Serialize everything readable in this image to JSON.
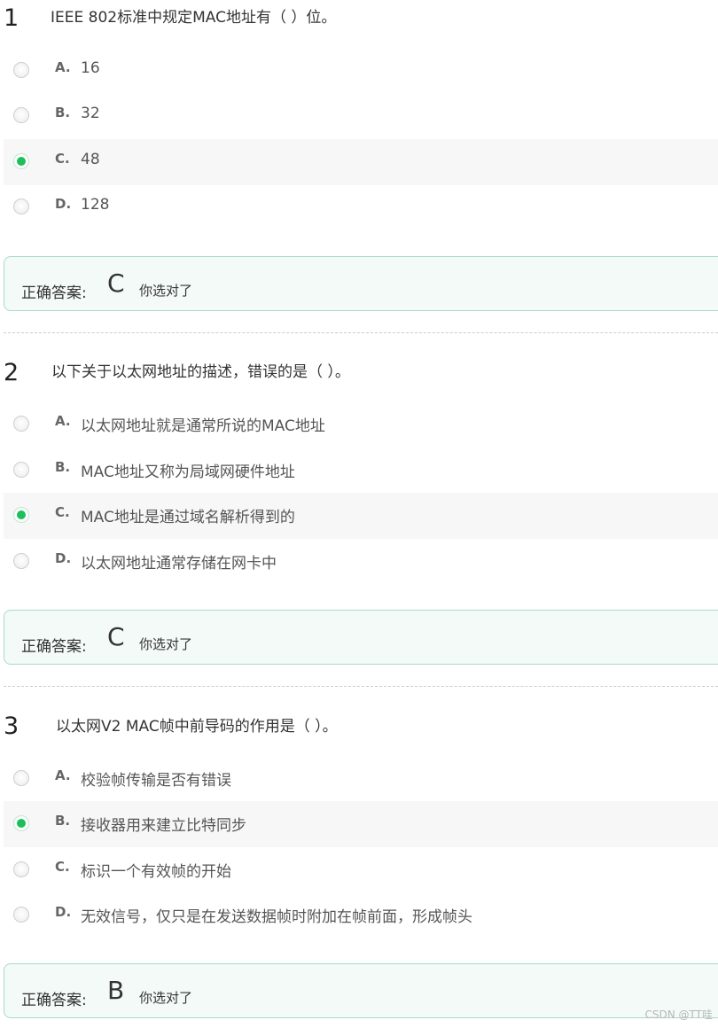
{
  "questions": [
    {
      "number": "1",
      "text": "IEEE 802标准中规定MAC地址有（    ）位。",
      "options": [
        {
          "letter": "A.",
          "text": "16",
          "selected": false
        },
        {
          "letter": "B.",
          "text": "32",
          "selected": false
        },
        {
          "letter": "C.",
          "text": "48",
          "selected": true
        },
        {
          "letter": "D.",
          "text": " 128",
          "selected": false
        }
      ],
      "answer_label": "正确答案:",
      "answer": "C",
      "result": "你选对了"
    },
    {
      "number": "2",
      "text": "以下关于以太网地址的描述，错误的是（    ）。",
      "options": [
        {
          "letter": "A.",
          "text": "以太网地址就是通常所说的MAC地址",
          "selected": false
        },
        {
          "letter": "B.",
          "text": "MAC地址又称为局域网硬件地址",
          "selected": false
        },
        {
          "letter": "C.",
          "text": "MAC地址是通过域名解析得到的",
          "selected": true
        },
        {
          "letter": "D.",
          "text": "以太网地址通常存储在网卡中",
          "selected": false
        }
      ],
      "answer_label": "正确答案:",
      "answer": "C",
      "result": "你选对了"
    },
    {
      "number": "3",
      "text": "以太网V2 MAC帧中前导码的作用是（    ）。",
      "options": [
        {
          "letter": "A.",
          "text": "校验帧传输是否有错误",
          "selected": false
        },
        {
          "letter": "B.",
          "text": "接收器用来建立比特同步",
          "selected": true
        },
        {
          "letter": "C.",
          "text": "标识一个有效帧的开始",
          "selected": false
        },
        {
          "letter": "D.",
          "text": "无效信号，仅只是在发送数据帧时附加在帧前面，形成帧头",
          "selected": false
        }
      ],
      "answer_label": "正确答案:",
      "answer": "B",
      "result": "你选对了"
    }
  ],
  "watermark": "CSDN @TT哇"
}
